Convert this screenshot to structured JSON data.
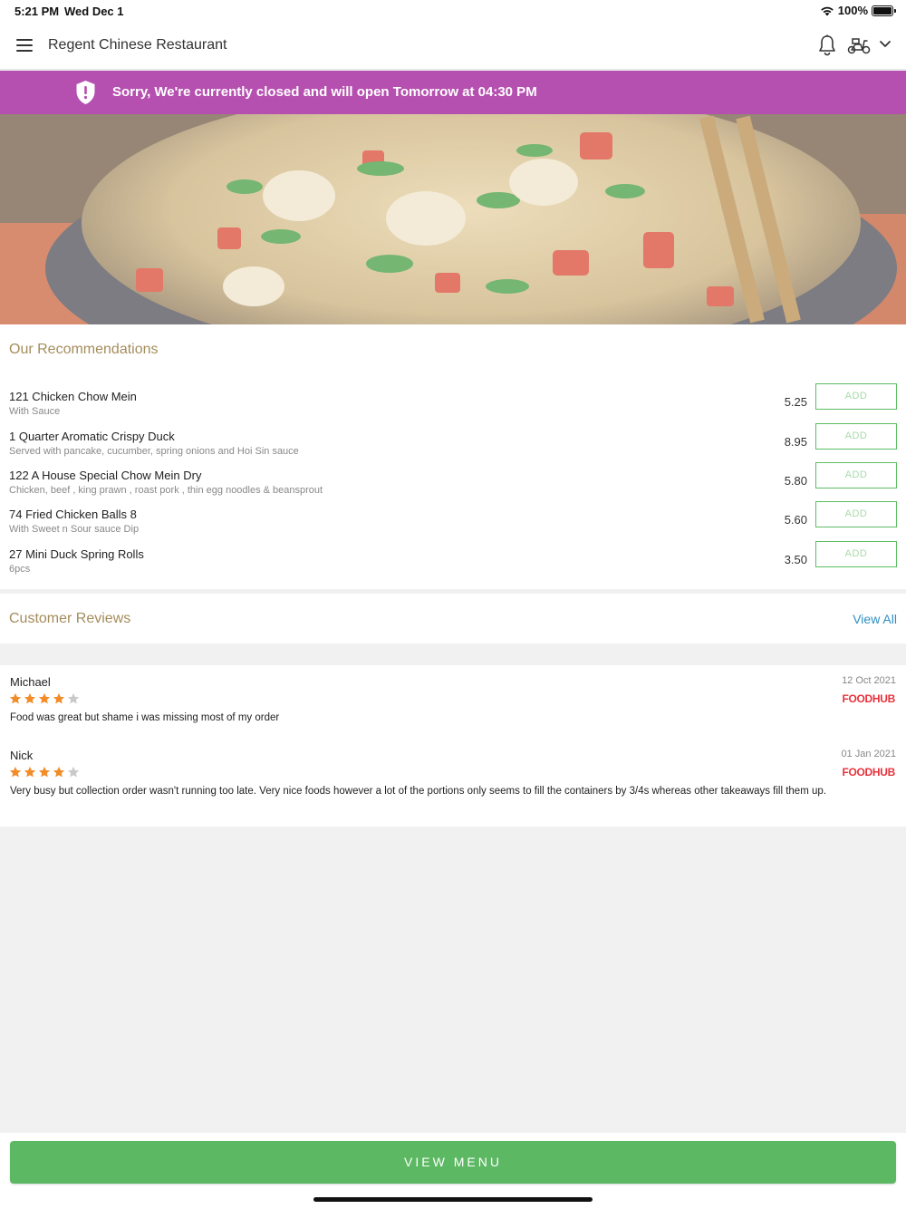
{
  "status_bar": {
    "time": "5:21 PM",
    "date": "Wed Dec 1",
    "battery": "100%"
  },
  "header": {
    "title": "Regent Chinese Restaurant"
  },
  "banner": {
    "message": "Sorry, We're currently closed and will open Tomorrow at 04:30 PM",
    "color": "#b650b0"
  },
  "recommendations": {
    "title": "Our Recommendations",
    "add_label": "ADD",
    "items": [
      {
        "name": "121 Chicken Chow Mein",
        "description": "With Sauce",
        "price": "5.25"
      },
      {
        "name": "1 Quarter Aromatic Crispy Duck",
        "description": "Served with pancake, cucumber, spring onions and Hoi Sin sauce",
        "price": "8.95"
      },
      {
        "name": "122 A House Special Chow Mein Dry",
        "description": "Chicken, beef , king prawn , roast pork , thin egg noodles & beansprout",
        "price": "5.80"
      },
      {
        "name": "74 Fried Chicken Balls 8",
        "description": "With Sweet n Sour sauce Dip",
        "price": "5.60"
      },
      {
        "name": "27 Mini Duck Spring Rolls",
        "description": "6pcs",
        "price": "3.50"
      }
    ]
  },
  "reviews": {
    "title": "Customer Reviews",
    "view_all_label": "View All",
    "items": [
      {
        "reviewer": "Michael",
        "date": "12 Oct 2021",
        "rating": 4,
        "source": "FOODHUB",
        "text": "Food was great but shame i was missing most of my order"
      },
      {
        "reviewer": "Nick",
        "date": "01 Jan 2021",
        "rating": 4,
        "source": "FOODHUB",
        "text": "Very busy but collection order wasn't running too late. Very nice foods however a lot of the portions only seems to fill the containers by 3/4s whereas other takeaways fill them up."
      }
    ]
  },
  "footer": {
    "view_menu_label": "VIEW MENU",
    "accent_color": "#5cb863"
  }
}
